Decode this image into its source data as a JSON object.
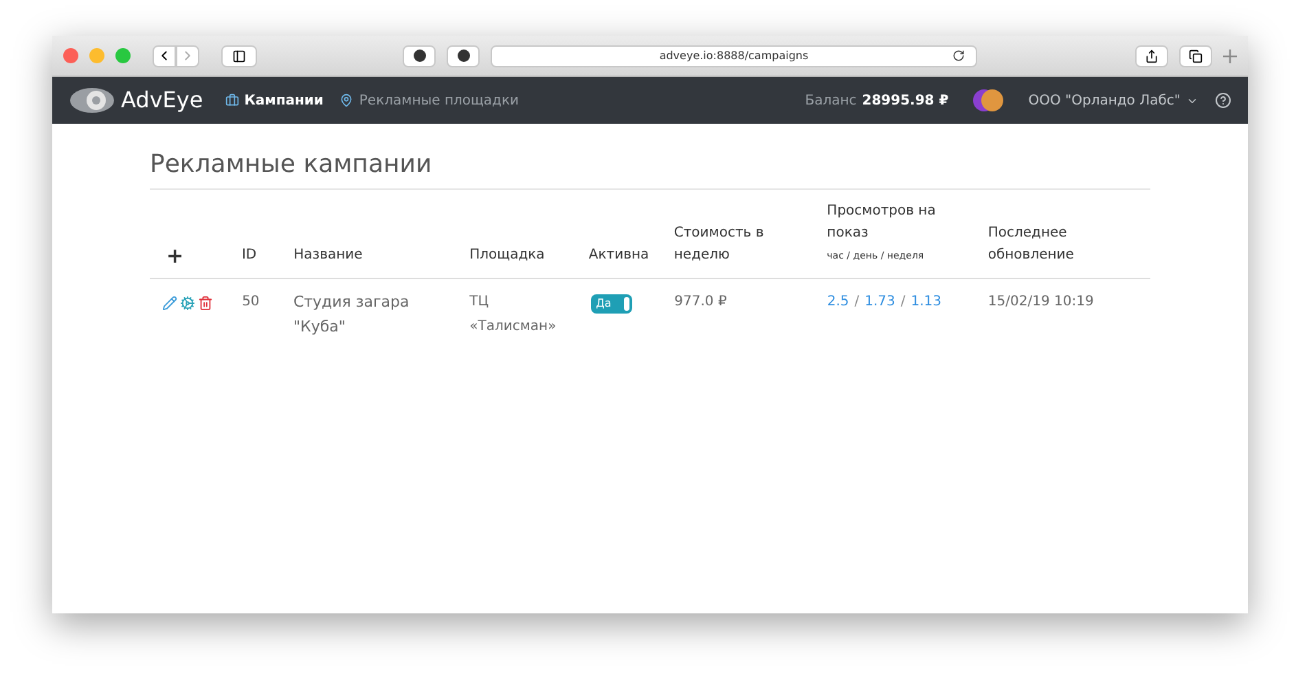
{
  "browser": {
    "url": "adveye.io:8888/campaigns"
  },
  "navbar": {
    "logo": "AdvEye",
    "links": [
      {
        "label": "Кампании",
        "selected": true
      },
      {
        "label": "Рекламные площадки",
        "selected": false
      }
    ],
    "balance_label": "Баланс",
    "balance_value": "28995.98 ₽",
    "account": "ООО \"Орландо Лабс\""
  },
  "page": {
    "title": "Рекламные кампании"
  },
  "table": {
    "add": "+",
    "columns": [
      {
        "label": "ID"
      },
      {
        "label": "Название"
      },
      {
        "label": "Площадка"
      },
      {
        "label": "Активна"
      },
      {
        "label": "Стоимость в неделю"
      },
      {
        "label": "Просмотров на показ",
        "sublabel": "час / день / неделя"
      },
      {
        "label": "Последнее обновление"
      }
    ],
    "rows": [
      {
        "id": "50",
        "name": "Студия загара \"Куба\"",
        "place": "ТЦ «Талисман»",
        "active": {
          "label": "Да",
          "on": true
        },
        "cost": "977.0 ₽",
        "views": [
          "2.5",
          "1.73",
          "1.13"
        ],
        "views_separator": "/",
        "updated": "15/02/19 10:19"
      }
    ]
  }
}
